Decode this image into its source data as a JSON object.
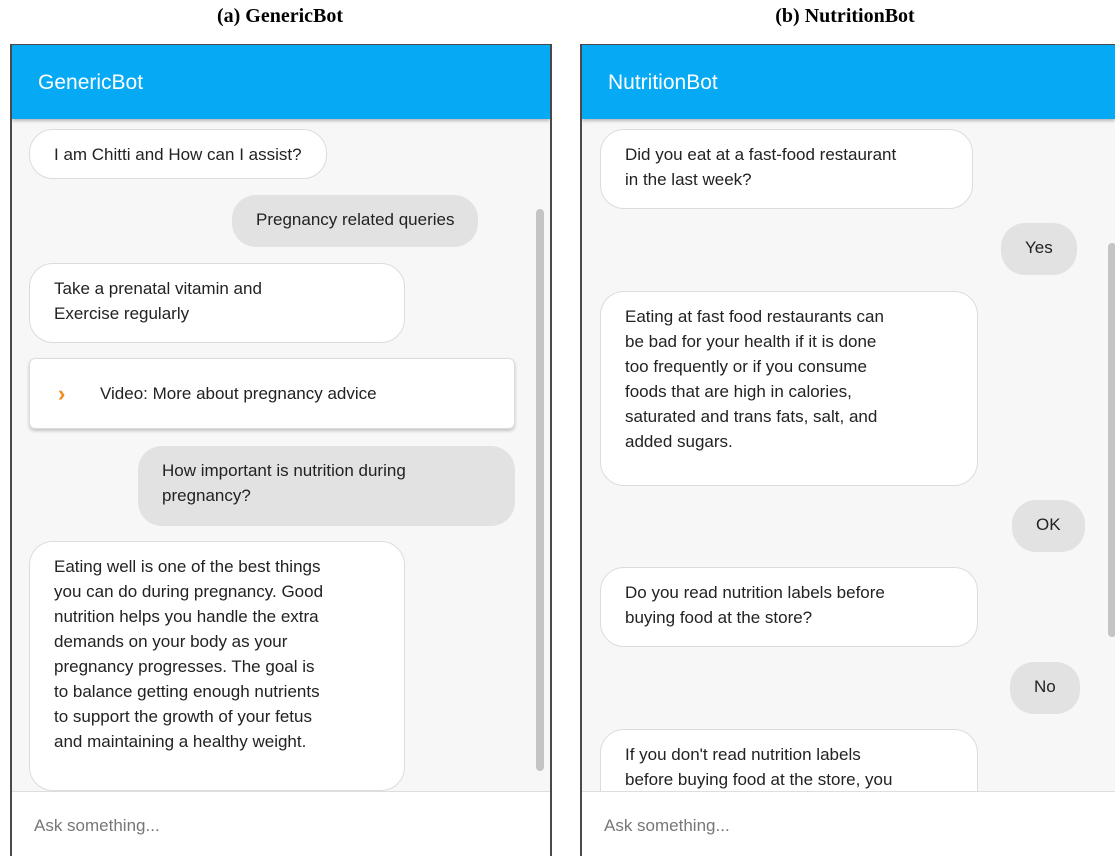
{
  "captions": {
    "left": "(a) GenericBot",
    "right": "(b) NutritionBot"
  },
  "generic": {
    "title": "GenericBot",
    "messages": [
      "I am Chitti and How can I assist?",
      "Pregnancy related queries",
      "Take a prenatal vitamin and\nExercise regularly",
      "How important is nutrition during\npregnancy?",
      "Eating well is one of the best things\nyou can do during pregnancy. Good\nnutrition helps you handle the extra\ndemands on your body as your\npregnancy progresses. The goal is\nto balance getting enough nutrients\nto support the growth of your fetus\nand maintaining a healthy weight."
    ],
    "video_card": "Video: More about pregnancy advice",
    "input_placeholder": "Ask something..."
  },
  "nutrition": {
    "title": "NutritionBot",
    "messages": [
      "Did you eat at a fast-food restaurant\nin the last week?",
      "Yes",
      "Eating at fast food restaurants can\nbe bad for your health if it is done\ntoo frequently or if you consume\nfoods that are high in calories,\nsaturated and trans fats, salt, and\nadded sugars.",
      "OK",
      "Do you read nutrition labels before\nbuying food at the store?",
      "No",
      "If you don't read nutrition labels\nbefore buying food at the store, you"
    ],
    "input_placeholder": "Ask something..."
  },
  "icons": {
    "video_card_icon": "chevron-right-icon"
  },
  "colors": {
    "header": "#05a9f4",
    "chevron": "#f08a18",
    "user_bubble": "#e2e2e2"
  }
}
